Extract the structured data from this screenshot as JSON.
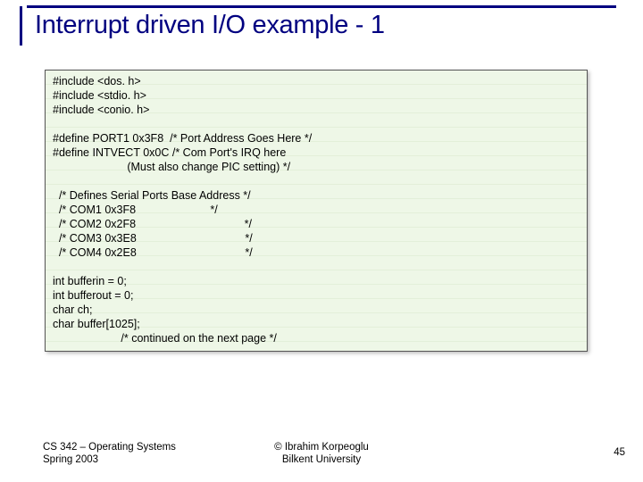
{
  "title": "Interrupt driven I/O example - 1",
  "code": "#include <dos. h>\n#include <stdio. h>\n#include <conio. h>\n\n#define PORT1 0x3F8  /* Port Address Goes Here */\n#define INTVECT 0x0C /* Com Port's IRQ here\n                        (Must also change PIC setting) */\n\n  /* Defines Serial Ports Base Address */\n  /* COM1 0x3F8                        */\n  /* COM2 0x2F8                                   */\n  /* COM3 0x3E8                                   */\n  /* COM4 0x2E8                                   */\n\nint bufferin = 0;\nint bufferout = 0;\nchar ch;\nchar buffer[1025];\n                      /* continued on the next page */",
  "footer": {
    "left_line1": "CS 342 – Operating Systems",
    "left_line2": "Spring 2003",
    "center_line1": "© Ibrahim Korpeoglu",
    "center_line2": "Bilkent University",
    "page": "45"
  }
}
